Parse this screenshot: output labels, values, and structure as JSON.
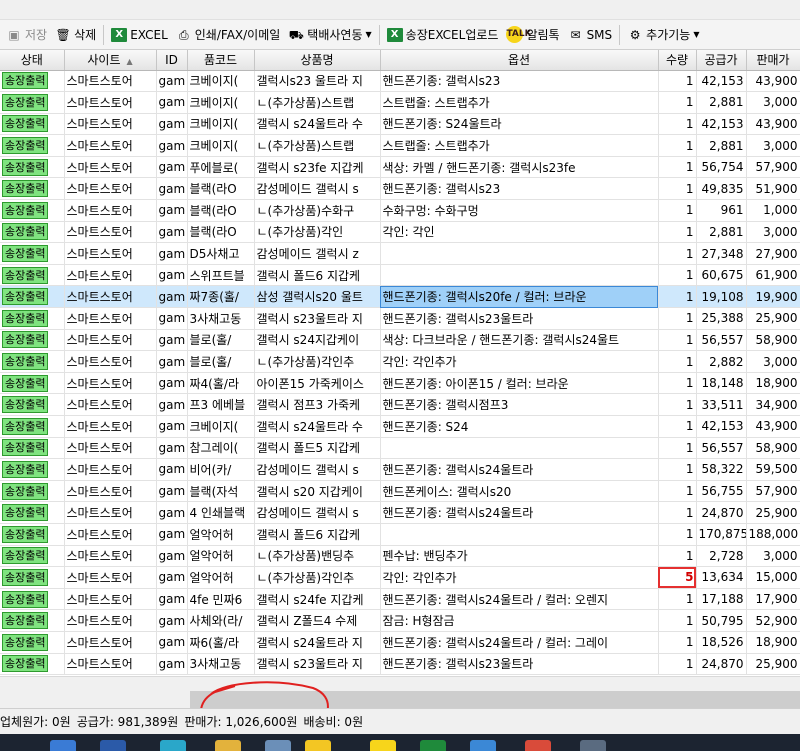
{
  "toolbar": {
    "items": [
      {
        "label": "저장",
        "icon": "save-icon",
        "disabled": true
      },
      {
        "label": "삭제",
        "icon": "trash-icon"
      },
      {
        "label": "EXCEL",
        "icon": "excel-icon"
      },
      {
        "label": "인쇄/FAX/이메일",
        "icon": "printer-icon"
      },
      {
        "label": "택배사연동",
        "icon": "truck-icon",
        "dropdown": true
      },
      {
        "label": "송장EXCEL업로드",
        "icon": "excel-icon"
      },
      {
        "label": "알림톡",
        "icon": "talk-icon"
      },
      {
        "label": "SMS",
        "icon": "envelope-icon"
      },
      {
        "label": "추가기능",
        "icon": "tools-icon",
        "dropdown": true
      }
    ]
  },
  "grid": {
    "columns": [
      "상태",
      "사이트",
      "ID",
      "품코드",
      "상품명",
      "옵션",
      "수량",
      "공급가",
      "판매가"
    ],
    "rows": [
      {
        "status": "송장출력",
        "site": "스마트스토어",
        "id": "gam",
        "code": "크베이지(",
        "name": "갤럭시s23 울트라 지",
        "option": "핸드폰기종: 갤럭시s23",
        "qty": "1",
        "supply": "42,153",
        "price": "43,900"
      },
      {
        "status": "송장출력",
        "site": "스마트스토어",
        "id": "gam",
        "code": "크베이지(",
        "name": "ㄴ(추가상품)스트랩",
        "option": "스트랩줄: 스트랩추가",
        "qty": "1",
        "supply": "2,881",
        "price": "3,000"
      },
      {
        "status": "송장출력",
        "site": "스마트스토어",
        "id": "gam",
        "code": "크베이지(",
        "name": "갤럭시 s24울트라 수",
        "option": "핸드폰기종: S24울트라",
        "qty": "1",
        "supply": "42,153",
        "price": "43,900"
      },
      {
        "status": "송장출력",
        "site": "스마트스토어",
        "id": "gam",
        "code": "크베이지(",
        "name": "ㄴ(추가상품)스트랩",
        "option": "스트랩줄: 스트랩추가",
        "qty": "1",
        "supply": "2,881",
        "price": "3,000"
      },
      {
        "status": "송장출력",
        "site": "스마트스토어",
        "id": "gam",
        "code": "푸에블로(",
        "name": "갤럭시 s23fe 지갑케",
        "option": "색상: 카멜 / 핸드폰기종: 갤럭시s23fe",
        "qty": "1",
        "supply": "56,754",
        "price": "57,900"
      },
      {
        "status": "송장출력",
        "site": "스마트스토어",
        "id": "gam",
        "code": "블랙(라O",
        "name": "감성메이드 갤럭시 s",
        "option": "핸드폰기종: 갤럭시s23",
        "qty": "1",
        "supply": "49,835",
        "price": "51,900"
      },
      {
        "status": "송장출력",
        "site": "스마트스토어",
        "id": "gam",
        "code": "블랙(라O",
        "name": "ㄴ(추가상품)수화구",
        "option": "수화구멍: 수화구멍",
        "qty": "1",
        "supply": "961",
        "price": "1,000"
      },
      {
        "status": "송장출력",
        "site": "스마트스토어",
        "id": "gam",
        "code": "블랙(라O",
        "name": "ㄴ(추가상품)각인",
        "option": "각인: 각인",
        "qty": "1",
        "supply": "2,881",
        "price": "3,000"
      },
      {
        "status": "송장출력",
        "site": "스마트스토어",
        "id": "gam",
        "code": "D5사채고",
        "name": "감성메이드 갤럭시 z",
        "option": "",
        "qty": "1",
        "supply": "27,348",
        "price": "27,900"
      },
      {
        "status": "송장출력",
        "site": "스마트스토어",
        "id": "gam",
        "code": "스위프트블",
        "name": "갤럭시 폴드6 지갑케",
        "option": "",
        "qty": "1",
        "supply": "60,675",
        "price": "61,900"
      },
      {
        "status": "송장출력",
        "site": "스마트스토어",
        "id": "gam",
        "code": "짜7종(홀/",
        "name": "삼성 갤럭시s20 울트",
        "option": "핸드폰기종: 갤럭시s20fe / 컬러: 브라운",
        "qty": "1",
        "supply": "19,108",
        "price": "19,900",
        "selected": true
      },
      {
        "status": "송장출력",
        "site": "스마트스토어",
        "id": "gam",
        "code": "3사채고동",
        "name": "갤럭시 s23울트라 지",
        "option": "핸드폰기종: 갤럭시s23울트라",
        "qty": "1",
        "supply": "25,388",
        "price": "25,900"
      },
      {
        "status": "송장출력",
        "site": "스마트스토어",
        "id": "gam",
        "code": "블로(홀/",
        "name": "갤럭시 s24지갑케이",
        "option": "색상: 다크브라운 / 핸드폰기종: 갤럭시s24울트",
        "qty": "1",
        "supply": "56,557",
        "price": "58,900"
      },
      {
        "status": "송장출력",
        "site": "스마트스토어",
        "id": "gam",
        "code": "블로(홀/",
        "name": "ㄴ(추가상품)각인추",
        "option": "각인: 각인추가",
        "qty": "1",
        "supply": "2,882",
        "price": "3,000"
      },
      {
        "status": "송장출력",
        "site": "스마트스토어",
        "id": "gam",
        "code": "짜4(홀/라",
        "name": "아이폰15 가죽케이스",
        "option": "핸드폰기종: 아이폰15 / 컬러: 브라운",
        "qty": "1",
        "supply": "18,148",
        "price": "18,900"
      },
      {
        "status": "송장출력",
        "site": "스마트스토어",
        "id": "gam",
        "code": "프3 에베블",
        "name": "갤럭시 점프3 가죽케",
        "option": "핸드폰기종: 갤럭시점프3",
        "qty": "1",
        "supply": "33,511",
        "price": "34,900"
      },
      {
        "status": "송장출력",
        "site": "스마트스토어",
        "id": "gam",
        "code": "크베이지(",
        "name": "갤럭시 s24울트라 수",
        "option": "핸드폰기종: S24",
        "qty": "1",
        "supply": "42,153",
        "price": "43,900"
      },
      {
        "status": "송장출력",
        "site": "스마트스토어",
        "id": "gam",
        "code": "참그레이(",
        "name": "갤럭시 폴드5 지갑케",
        "option": "",
        "qty": "1",
        "supply": "56,557",
        "price": "58,900"
      },
      {
        "status": "송장출력",
        "site": "스마트스토어",
        "id": "gam",
        "code": "비어(카/",
        "name": "감성메이드 갤럭시 s",
        "option": "핸드폰기종: 갤럭시s24울트라",
        "qty": "1",
        "supply": "58,322",
        "price": "59,500"
      },
      {
        "status": "송장출력",
        "site": "스마트스토어",
        "id": "gam",
        "code": "블랙(자석",
        "name": "갤럭시 s20 지갑케이",
        "option": "핸드폰케이스: 갤럭시s20",
        "qty": "1",
        "supply": "56,755",
        "price": "57,900"
      },
      {
        "status": "송장출력",
        "site": "스마트스토어",
        "id": "gam",
        "code": "4 인쇄블랙",
        "name": "감성메이드 갤럭시 s",
        "option": "핸드폰기종: 갤럭시s24울트라",
        "qty": "1",
        "supply": "24,870",
        "price": "25,900"
      },
      {
        "status": "송장출력",
        "site": "스마트스토어",
        "id": "gam",
        "code": "얼악어허",
        "name": "갤럭시 폴드6 지갑케",
        "option": "",
        "qty": "1",
        "supply": "170,875",
        "price": "188,000"
      },
      {
        "status": "송장출력",
        "site": "스마트스토어",
        "id": "gam",
        "code": "얼악어허",
        "name": "ㄴ(추가상품)밴딩추",
        "option": "펜수납: 밴딩추가",
        "qty": "1",
        "supply": "2,728",
        "price": "3,000"
      },
      {
        "status": "송장출력",
        "site": "스마트스토어",
        "id": "gam",
        "code": "얼악어허",
        "name": "ㄴ(추가상품)각인추",
        "option": "각인: 각인추가",
        "qty": "5",
        "supply": "13,634",
        "price": "15,000",
        "qty_edit": true
      },
      {
        "status": "송장출력",
        "site": "스마트스토어",
        "id": "gam",
        "code": "4fe 민짜6",
        "name": "갤럭시 s24fe 지갑케",
        "option": "핸드폰기종: 갤럭시s24울트라 / 컬러: 오렌지",
        "qty": "1",
        "supply": "17,188",
        "price": "17,900"
      },
      {
        "status": "송장출력",
        "site": "스마트스토어",
        "id": "gam",
        "code": "사체와(라/",
        "name": "갤럭시 Z폴드4 수제",
        "option": "잠금: H형잠금",
        "qty": "1",
        "supply": "50,795",
        "price": "52,900"
      },
      {
        "status": "송장출력",
        "site": "스마트스토어",
        "id": "gam",
        "code": "짜6(홀/라",
        "name": "갤럭시 s24울트라 지",
        "option": "핸드폰기종: 갤럭시s24울트라 / 컬러: 그레이",
        "qty": "1",
        "supply": "18,526",
        "price": "18,900"
      },
      {
        "status": "송장출력",
        "site": "스마트스토어",
        "id": "gam",
        "code": "3사채고동",
        "name": "갤럭시 s23울트라 지",
        "option": "핸드폰기종: 갤럭시s23울트라",
        "qty": "1",
        "supply": "24,870",
        "price": "25,900"
      }
    ]
  },
  "statusbar": {
    "items": [
      "업체원가: 0원",
      "공급가: 981,389원",
      "판매가: 1,026,600원",
      "배송비: 0원"
    ]
  },
  "colors": {
    "status_badge": "#7fe37f",
    "selected_row": "#cfe8fc",
    "annotation": "#e0201f"
  }
}
